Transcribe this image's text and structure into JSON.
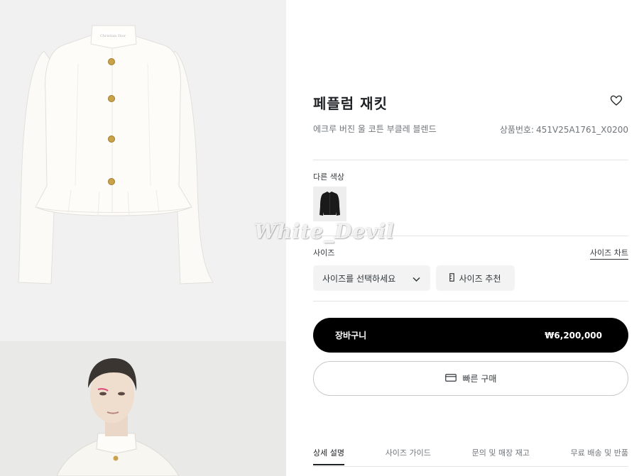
{
  "product": {
    "title": "페플럼 재킷",
    "description": "에크루 버진 울 코튼 부클레 블렌드",
    "sku_label": "상품번호:",
    "sku_value": "451V25A1761_X0200",
    "label_text": "Christian Dior"
  },
  "watermark": "White_Devil",
  "colors": {
    "label": "다른 색상",
    "swatch_color": "#1a1a1a"
  },
  "size": {
    "label": "사이즈",
    "chart_link": "사이즈 차트",
    "select_placeholder": "사이즈를 선택하세요",
    "recommend_label": "사이즈 추천"
  },
  "actions": {
    "cart_label": "장바구니",
    "price": "₩6,200,000",
    "quick_buy_label": "빠른 구매"
  },
  "tabs": [
    {
      "label": "상세 설명",
      "active": true
    },
    {
      "label": "사이즈 가이드",
      "active": false
    },
    {
      "label": "문의 및 매장 재고",
      "active": false
    },
    {
      "label": "무료 배송 및 반품",
      "active": false
    }
  ]
}
